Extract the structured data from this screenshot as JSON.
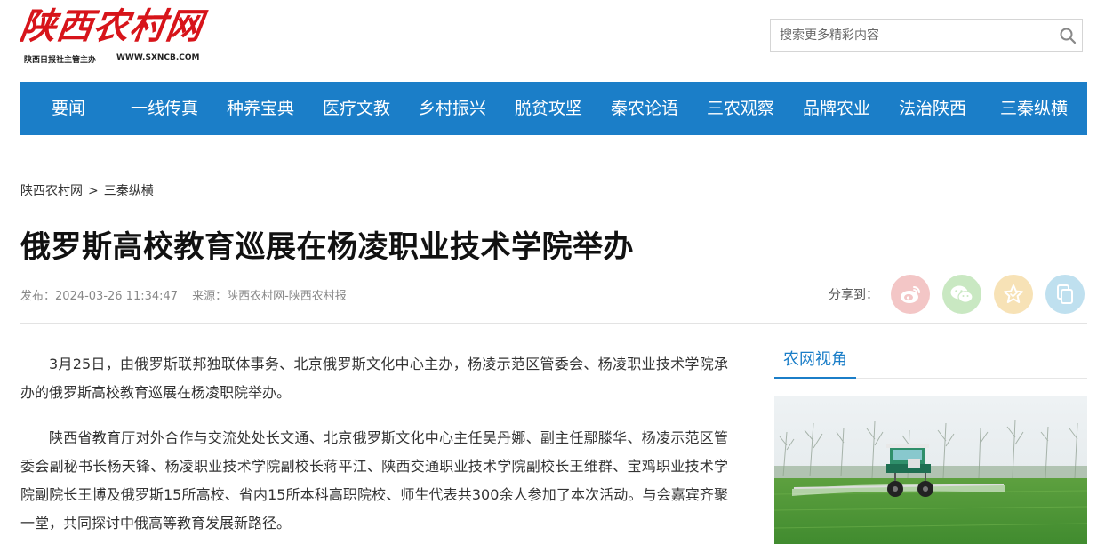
{
  "header": {
    "logo_text": "陕西农村网",
    "logo_sub": "陕西日报社主管主办",
    "logo_url": "WWW.SXNCB.COM",
    "search_placeholder": "搜索更多精彩内容"
  },
  "nav": {
    "items": [
      {
        "label": "要闻"
      },
      {
        "label": "一线传真"
      },
      {
        "label": "种养宝典"
      },
      {
        "label": "医疗文教"
      },
      {
        "label": "乡村振兴"
      },
      {
        "label": "脱贫攻坚"
      },
      {
        "label": "秦农论语"
      },
      {
        "label": "三农观察"
      },
      {
        "label": "品牌农业"
      },
      {
        "label": "法治陕西"
      },
      {
        "label": "三秦纵横"
      }
    ]
  },
  "breadcrumb": {
    "home": "陕西农村网",
    "separator": ">",
    "current": "三秦纵横"
  },
  "article": {
    "title": "俄罗斯高校教育巡展在杨凌职业技术学院举办",
    "publish_label": "发布：2024-03-26 11:34:47",
    "source_label": "来源：陕西农村网-陕西农村报",
    "paragraphs": [
      "3月25日，由俄罗斯联邦独联体事务、北京俄罗斯文化中心主办，杨凌示范区管委会、杨凌职业技术学院承办的俄罗斯高校教育巡展在杨凌职院举办。",
      "陕西省教育厅对外合作与交流处处长文通、北京俄罗斯文化中心主任吴丹娜、副主任鄢滕华、杨凌示范区管委会副秘书长杨天锋、杨凌职业技术学院副校长蒋平江、陕西交通职业技术学院副校长王维群、宝鸡职业技术学院副院长王博及俄罗斯15所高校、省内15所本科高职院校、师生代表共300余人参加了本次活动。与会嘉宾齐聚一堂，共同探讨中俄高等教育发展新路径。"
    ]
  },
  "share": {
    "label": "分享到：",
    "icons": [
      "weibo-icon",
      "wechat-icon",
      "favorite-icon",
      "copy-icon"
    ],
    "colors": {
      "weibo": "#f3c6c6",
      "wechat": "#c9e8c2",
      "favorite": "#f7e2b6",
      "copy": "#bfe0ef"
    }
  },
  "sidebar": {
    "tab_label": "农网视角"
  },
  "colors": {
    "brand_red": "#d7141a",
    "nav_blue": "#1b7ec8"
  }
}
